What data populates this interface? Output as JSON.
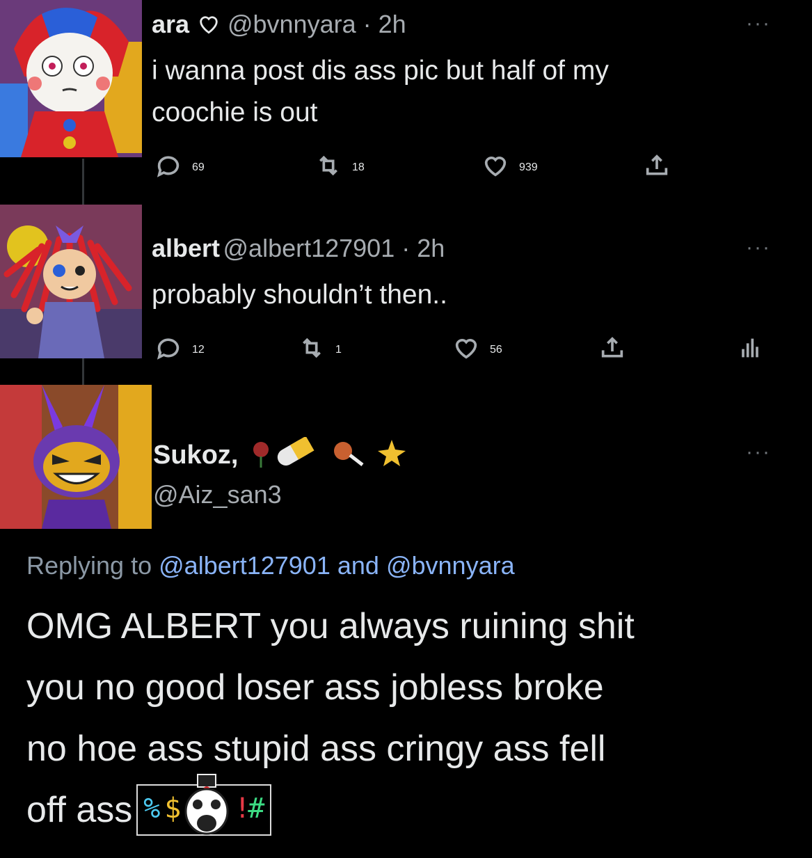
{
  "tweets": [
    {
      "name": "ara",
      "handle": "@bvnnyara · 2h",
      "text_lines": [
        "i wanna post dis ass pic but half of my",
        "coochie is out"
      ],
      "replies": "69",
      "retweets": "18",
      "likes": "939"
    },
    {
      "name": "albert",
      "handle": "@albert127901 · 2h",
      "text_lines": [
        "probably shouldn’t then.."
      ],
      "replies": "12",
      "retweets": "1",
      "likes": "56"
    }
  ],
  "reply": {
    "name": "Sukoz,",
    "handle": "@Aiz_san3",
    "replying_prefix": "Replying to",
    "mention_1": "@albert127901",
    "and_word": "and",
    "mention_2": "@bvnnyara",
    "text_lines": [
      "OMG ALBERT you always ruining shit",
      "you no good loser ass jobless broke",
      "no hoe ass stupid ass cringy ass fell",
      "off ass"
    ],
    "sticker_symbols": [
      "%",
      "$",
      "!",
      "#"
    ]
  },
  "more_icon": "···",
  "colors": {
    "background": "#000000",
    "text": "#e7e9ea",
    "secondary": "#a7acb1",
    "mention": "#8ab4f8"
  },
  "icons": [
    "reply-icon",
    "retweet-icon",
    "heart-icon",
    "share-icon",
    "analytics-icon",
    "more-icon"
  ]
}
